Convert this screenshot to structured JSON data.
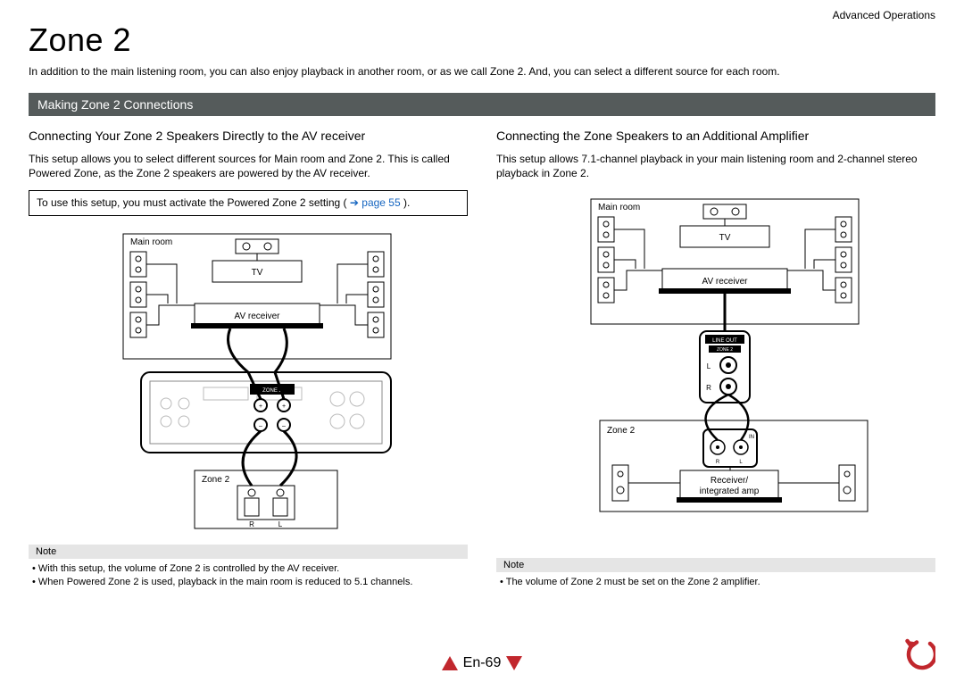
{
  "header": {
    "section": "Advanced Operations"
  },
  "title": "Zone 2",
  "intro": "In addition to the main listening room, you can also enjoy playback in another room, or as we call Zone 2. And, you can select a different source for each room.",
  "section_bar": "Making Zone 2 Connections",
  "left": {
    "heading": "Connecting Your Zone 2 Speakers Directly to the AV receiver",
    "body": "This setup allows you to select different sources for Main room and Zone 2. This is called Powered Zone, as the Zone 2 speakers are powered by the AV receiver.",
    "callout_prefix": "To use this setup, you must activate the Powered Zone 2 setting (",
    "callout_link": "➔ page 55",
    "callout_suffix": ").",
    "diagram": {
      "main_room": "Main room",
      "tv": "TV",
      "receiver": "AV receiver",
      "zone_panel": "ZONE 2",
      "zone2": "Zone 2",
      "r": "R",
      "l": "L"
    },
    "note_label": "Note",
    "notes": [
      "With this setup, the volume of Zone 2 is controlled by the AV receiver.",
      "When Powered Zone 2 is used, playback in the main room is reduced to 5.1 channels."
    ]
  },
  "right": {
    "heading": "Connecting the Zone Speakers to an Additional Amplifier",
    "body": "This setup allows 7.1-channel playback in your main listening room and 2-channel stereo playback in Zone 2.",
    "diagram": {
      "main_room": "Main room",
      "tv": "TV",
      "receiver": "AV receiver",
      "lineout": "LINE OUT",
      "zone2_small": "ZONE 2",
      "l": "L",
      "r": "R",
      "zone2": "Zone 2",
      "in": "IN",
      "amp_line1": "Receiver/",
      "amp_line2": "integrated amp"
    },
    "note_label": "Note",
    "notes": [
      "The volume of Zone 2 must be set on the Zone 2 amplifier."
    ]
  },
  "footer": {
    "page": "En-69"
  }
}
